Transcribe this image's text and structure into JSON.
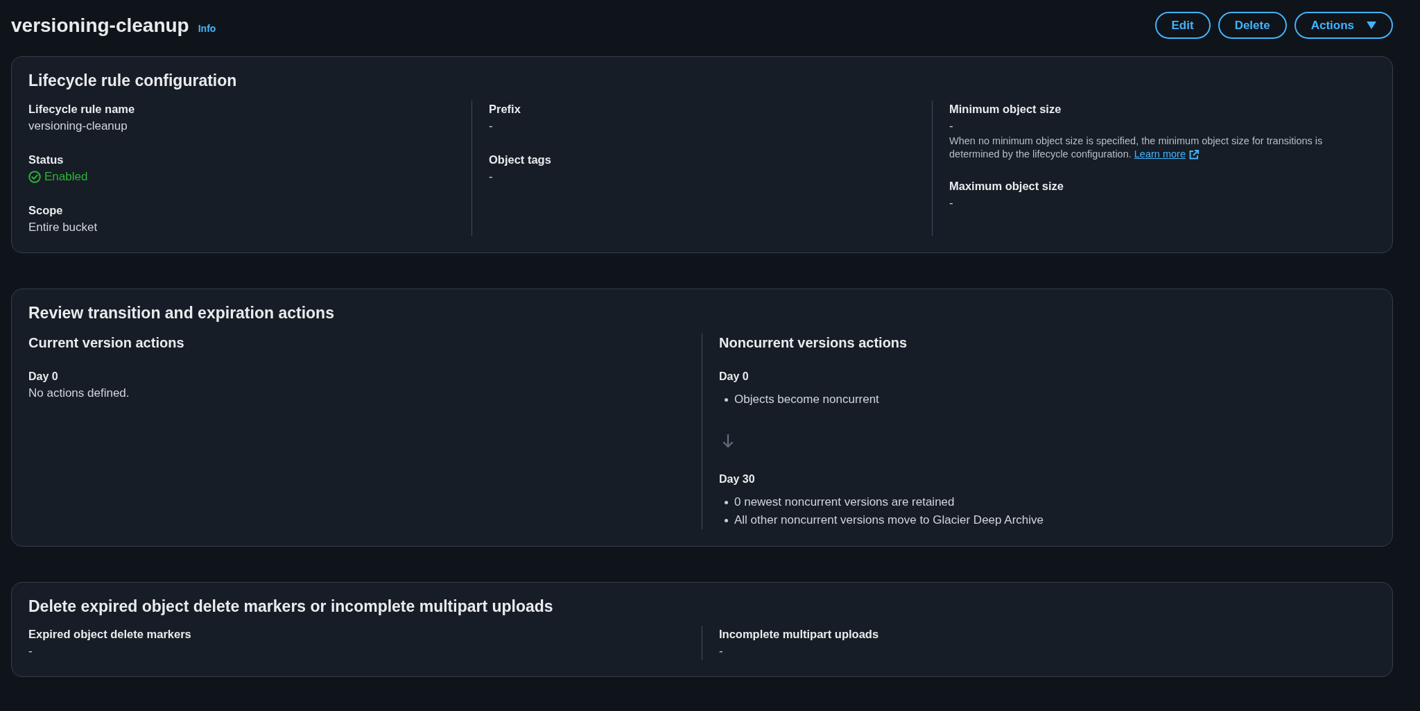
{
  "header": {
    "title": "versioning-cleanup",
    "info_link": "Info",
    "buttons": [
      {
        "label": "Edit",
        "kind": "normal"
      },
      {
        "label": "Delete",
        "kind": "normal"
      },
      {
        "label": "Actions",
        "kind": "dropdown"
      }
    ]
  },
  "rule_configuration": {
    "title": "Lifecycle rule configuration",
    "columns": [
      [
        {
          "label": "Lifecycle rule name",
          "value": "versioning-cleanup",
          "kind": "text"
        },
        {
          "label": "Status",
          "value": "Enabled",
          "kind": "status"
        },
        {
          "label": "Scope",
          "value": "Entire bucket",
          "kind": "text"
        }
      ],
      [
        {
          "label": "Prefix",
          "value": "-",
          "kind": "text"
        },
        {
          "label": "Object tags",
          "value": "-",
          "kind": "text"
        }
      ],
      [
        {
          "label": "Minimum object size",
          "value": "-",
          "kind": "text",
          "description": "When no minimum object size is specified, the minimum object size for transitions is determined by the lifecycle configuration.",
          "link": "Learn more"
        },
        {
          "label": "Maximum object size",
          "value": "-",
          "kind": "text"
        }
      ]
    ]
  },
  "review": {
    "title": "Review transition and expiration actions",
    "columns": [
      {
        "title": "Current version actions",
        "steps": [
          {
            "day": "Day 0",
            "kind": "note",
            "text": "No actions defined."
          }
        ]
      },
      {
        "title": "Noncurrent versions actions",
        "steps": [
          {
            "day": "Day 0",
            "kind": "list",
            "items": [
              "Objects become noncurrent"
            ]
          },
          {
            "day": "Day 30",
            "kind": "list",
            "items": [
              "0 newest noncurrent versions are retained",
              "All other noncurrent versions move to Glacier Deep Archive"
            ]
          }
        ]
      }
    ]
  },
  "cleanup": {
    "title": "Delete expired object delete markers or incomplete multipart uploads",
    "fields": [
      {
        "label": "Expired object delete markers",
        "value": "-"
      },
      {
        "label": "Incomplete multipart uploads",
        "value": "-"
      }
    ]
  }
}
